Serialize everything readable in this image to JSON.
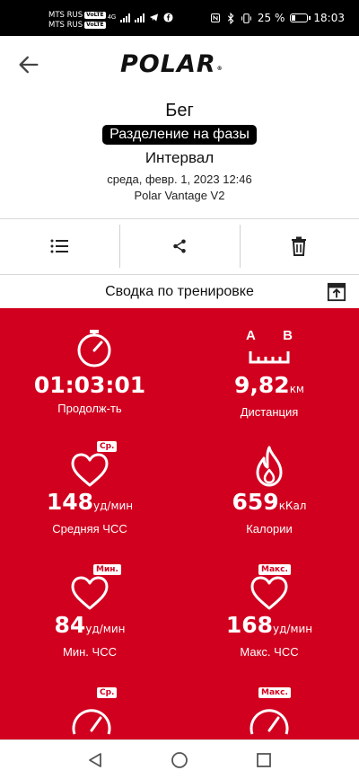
{
  "status_bar": {
    "carrier1": "MTS RUS",
    "carrier2": "MTS RUS",
    "volte": "VoLTE",
    "net_type": "4G",
    "battery": "25 %",
    "time": "18:03"
  },
  "header": {
    "logo": "POLAR"
  },
  "training": {
    "sport": "Бег",
    "phase_label": "Разделение на фазы",
    "type": "Интервал",
    "datetime": "среда, февр. 1, 2023 12:46",
    "device": "Polar Vantage V2"
  },
  "actions": [
    {
      "icon": "list-icon"
    },
    {
      "icon": "share-icon"
    },
    {
      "icon": "trash-icon"
    }
  ],
  "summary": {
    "title": "Сводка по тренировке"
  },
  "stats": {
    "duration": {
      "value": "01:03:01",
      "unit": "",
      "label": "Продолж-ть",
      "icon": "stopwatch-icon"
    },
    "distance": {
      "value": "9,82",
      "unit": "км",
      "label": "Дистанция",
      "icon": "distance-icon",
      "marker_a": "A",
      "marker_b": "B"
    },
    "avg_hr": {
      "value": "148",
      "unit": "уд/мин",
      "label": "Средняя ЧСС",
      "icon": "heart-icon",
      "badge": "Ср."
    },
    "calories": {
      "value": "659",
      "unit": "кКал",
      "label": "Калории",
      "icon": "flame-icon"
    },
    "min_hr": {
      "value": "84",
      "unit": "уд/мин",
      "label": "Мин. ЧСС",
      "icon": "heart-icon",
      "badge": "Мин."
    },
    "max_hr": {
      "value": "168",
      "unit": "уд/мин",
      "label": "Макс. ЧСС",
      "icon": "heart-icon",
      "badge": "Макс."
    },
    "avg_speed": {
      "badge": "Ср.",
      "icon": "speedometer-icon"
    },
    "max_speed": {
      "badge": "Макс.",
      "icon": "speedometer-icon"
    }
  },
  "colors": {
    "brand_red": "#d1001f",
    "text": "#111111"
  }
}
